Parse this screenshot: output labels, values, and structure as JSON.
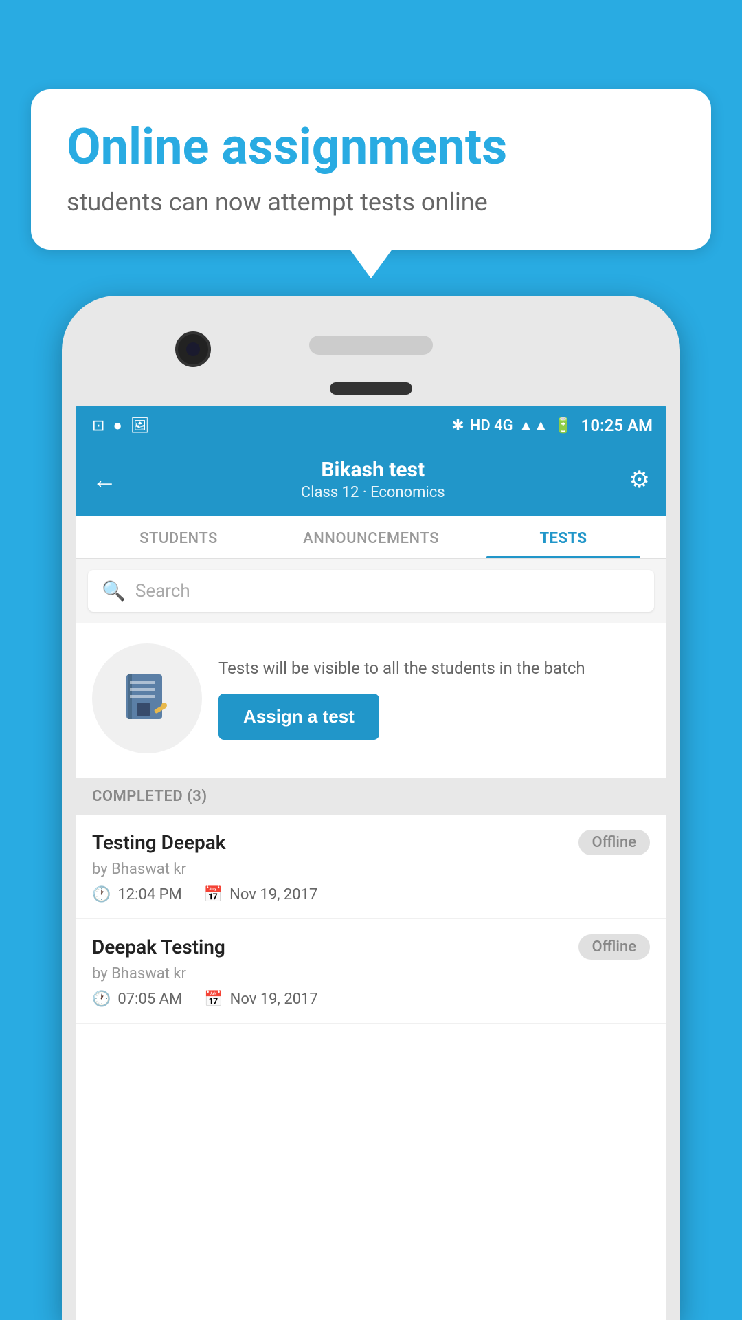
{
  "background_color": "#29ABE2",
  "bubble": {
    "title": "Online assignments",
    "subtitle": "students can now attempt tests online"
  },
  "status_bar": {
    "time": "10:25 AM",
    "signal_text": "HD 4G"
  },
  "header": {
    "title": "Bikash test",
    "subtitle": "Class 12 · Economics",
    "back_label": "←",
    "settings_label": "⚙"
  },
  "tabs": [
    {
      "label": "STUDENTS",
      "active": false
    },
    {
      "label": "ANNOUNCEMENTS",
      "active": false
    },
    {
      "label": "TESTS",
      "active": true
    }
  ],
  "search": {
    "placeholder": "Search"
  },
  "assign_card": {
    "description": "Tests will be visible to all the students in the batch",
    "button_label": "Assign a test"
  },
  "completed_section": {
    "label": "COMPLETED (3)"
  },
  "tests": [
    {
      "name": "Testing Deepak",
      "by": "by Bhaswat kr",
      "time": "12:04 PM",
      "date": "Nov 19, 2017",
      "badge": "Offline"
    },
    {
      "name": "Deepak Testing",
      "by": "by Bhaswat kr",
      "time": "07:05 AM",
      "date": "Nov 19, 2017",
      "badge": "Offline"
    }
  ]
}
